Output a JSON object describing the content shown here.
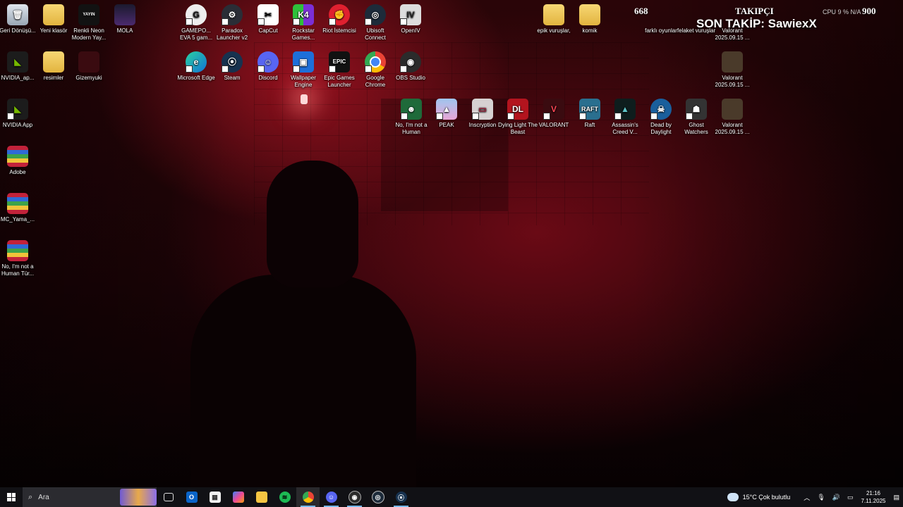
{
  "overlay": {
    "count_left": "668",
    "count_right": "900",
    "title": "TAKIPÇI",
    "last_follower": "SON TAKİP: SawiexX",
    "stats": "CPU   9 %      N/A"
  },
  "desktop": {
    "col1": [
      {
        "label": "Geri Dönüşü..."
      },
      {
        "label": "NVIDIA_ap..."
      },
      {
        "label": "NVIDIA App"
      },
      {
        "label": "Adobe"
      },
      {
        "label": "MC_Yama_..."
      },
      {
        "label": "No, I'm not a Human Tür..."
      }
    ],
    "col2": [
      {
        "label": "Yeni klasör"
      },
      {
        "label": "resimler"
      }
    ],
    "col3": [
      {
        "label": "Renkli Neon Modern Yay..."
      },
      {
        "label": "Gizemyuki"
      }
    ],
    "col4": [
      {
        "label": "MOLA"
      }
    ],
    "row1": [
      {
        "label": "GAMEPO... EVA 5 gam..."
      },
      {
        "label": "Paradox Launcher v2"
      },
      {
        "label": "CapCut"
      },
      {
        "label": "Rockstar Games..."
      },
      {
        "label": "Riot İstemcisi"
      },
      {
        "label": "Ubisoft Connect"
      },
      {
        "label": "OpenIV"
      }
    ],
    "row2": [
      {
        "label": "Microsoft Edge"
      },
      {
        "label": "Steam"
      },
      {
        "label": "Discord"
      },
      {
        "label": "Wallpaper Engine"
      },
      {
        "label": "Epic Games Launcher"
      },
      {
        "label": "Google Chrome"
      },
      {
        "label": "OBS Studio"
      }
    ],
    "row3": [
      {
        "label": "No, I'm not a Human"
      },
      {
        "label": "PEAK"
      },
      {
        "label": "Inscryption"
      },
      {
        "label": "Dying Light The Beast"
      },
      {
        "label": "VALORANT"
      },
      {
        "label": "Raft"
      },
      {
        "label": "Assassin's Creed V..."
      },
      {
        "label": "Dead by Daylight"
      },
      {
        "label": "Ghost Watchers"
      }
    ],
    "right": [
      {
        "label": "epik vuruşlar,"
      },
      {
        "label": "komik"
      },
      {
        "label": "farklı oyunlar"
      },
      {
        "label": "felaket vuruşlar"
      },
      {
        "label": "Valorant 2025.09.15 ..."
      },
      {
        "label": "Valorant 2025.09.15 ..."
      },
      {
        "label": "Valorant 2025.09.15 ..."
      }
    ]
  },
  "taskbar": {
    "search_placeholder": "Ara",
    "weather": "15°C  Çok bulutlu",
    "time": "21:16",
    "date": "7.11.2025"
  }
}
